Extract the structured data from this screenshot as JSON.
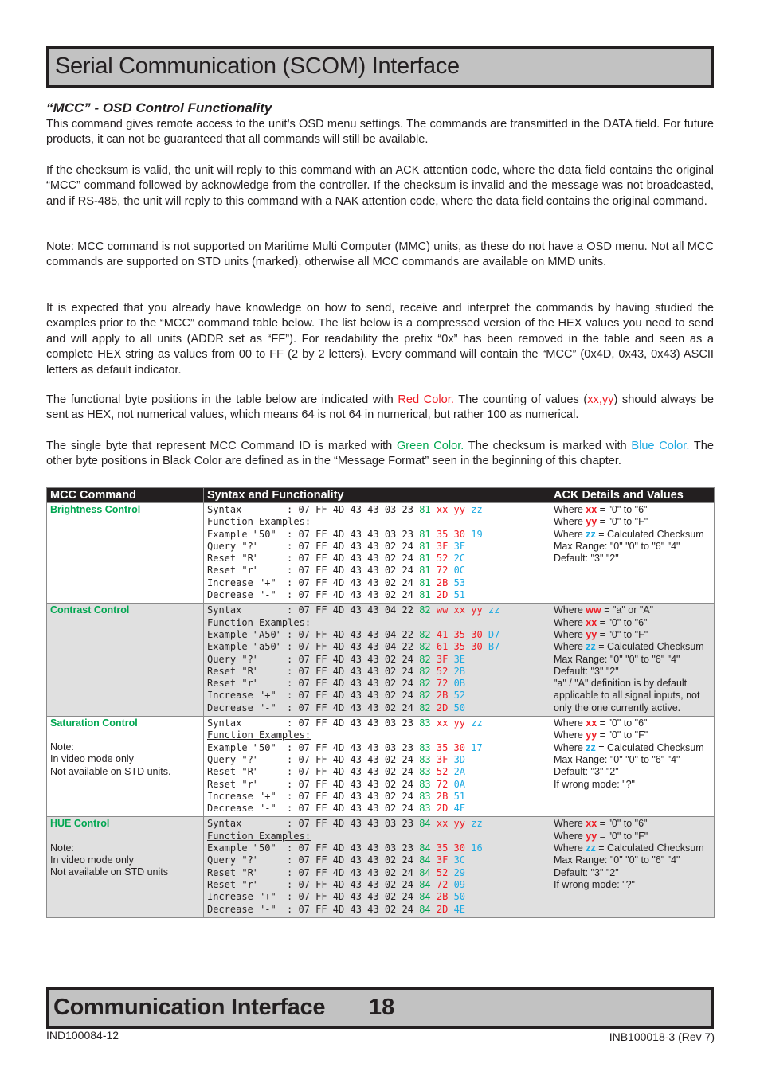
{
  "header": {
    "title": "Serial Communication (SCOM) Interface"
  },
  "section": {
    "heading": "“MCC” - OSD Control Functionality",
    "paragraphs": {
      "p1": "This command gives remote access to the unit’s OSD menu settings. The commands are transmitted in the DATA field. For future products, it can not be guaranteed that all commands will still be available.",
      "p2": "If the checksum is valid, the unit will reply to this command with an ACK attention code, where the data field contains the original “MCC” command followed by acknowledge from the controller. If the checksum is invalid and the message was not broadcasted, and if RS-485, the unit will reply to this command with a NAK attention code, where the data field contains the original command.",
      "p3": "Note: MCC command is not supported on Maritime Multi Computer (MMC) units, as these do not have a OSD menu. Not all MCC commands are supported on STD units (marked), otherwise all MCC commands are available on MMD units.",
      "p4": "It is expected that you already have knowledge on how to send, receive and interpret the commands by having studied the examples prior to the “MCC” command table below. The list below is a compressed version of the HEX values you need to send and will apply to all units (ADDR set as “FF”). For readability the prefix “0x” has been removed in the table and seen as a complete HEX string as values from 00 to FF (2 by 2 letters). Every command will contain the “MCC” (0x4D, 0x43, 0x43) ASCII letters as default indicator.",
      "p5a": "The functional byte positions in the table below are indicated with ",
      "p5red": "Red Color.",
      "p5b": " The counting of values (",
      "p5vals": "xx,yy",
      "p5c": ") should always be sent as HEX, not numerical values, which means 64 is not 64 in numerical, but rather 100 as numerical.",
      "p6a": "The single byte that represent MCC Command ID is marked with ",
      "p6green": "Green Color.",
      "p6b": " The checksum is marked with ",
      "p6blue": "Blue Color.",
      "p6c": " The other byte positions in Black Color are defined as in the “Message Format” seen in the beginning of this chapter."
    }
  },
  "colors": {
    "functional": "#ed1c24",
    "command_id": "#00a650",
    "checksum": "#1ca9e1",
    "header_bg": "#c2c2c2"
  },
  "table": {
    "headers": [
      "MCC Command",
      "Syntax and Functionality",
      "ACK Details and Values"
    ],
    "examples_label": "Function Examples:",
    "rows": [
      {
        "name": "Brightness Control",
        "notes": [],
        "syntax": {
          "label": "Syntax",
          "black": "07 FF 4D 43 43 03 23",
          "green": "81",
          "red": "xx yy",
          "blue": "zz"
        },
        "examples": [
          {
            "label": "Example \"50\"",
            "black": "07 FF 4D 43 43 03 23",
            "green": "81",
            "red": "35 30",
            "blue": "19"
          },
          {
            "label": "Query \"?\"",
            "black": "07 FF 4D 43 43 02 24",
            "green": "81",
            "red": "3F",
            "blue": "3F"
          },
          {
            "label": "Reset \"R\"",
            "black": "07 FF 4D 43 43 02 24",
            "green": "81",
            "red": "52",
            "blue": "2C"
          },
          {
            "label": "Reset \"r\"",
            "black": "07 FF 4D 43 43 02 24",
            "green": "81",
            "red": "72",
            "blue": "0C"
          },
          {
            "label": "Increase \"+\"",
            "black": "07 FF 4D 43 43 02 24",
            "green": "81",
            "red": "2B",
            "blue": "53"
          },
          {
            "label": "Decrease \"-\"",
            "black": "07 FF 4D 43 43 02 24",
            "green": "81",
            "red": "2D",
            "blue": "51"
          }
        ],
        "ack": {
          "where": [
            {
              "var": "xx",
              "color": "red",
              "text": " = \"0\" to \"6\""
            },
            {
              "var": "yy",
              "color": "red",
              "text": " = \"0\" to \"F\""
            },
            {
              "var": "zz",
              "color": "blue",
              "text": " = Calculated Checksum"
            }
          ],
          "max_range": "Max Range: \"0\" \"0\" to \"6\" \"4\"",
          "default": "Default: \"3\" \"2\"",
          "extra": []
        }
      },
      {
        "name": "Contrast Control",
        "notes": [],
        "syntax": {
          "label": "Syntax",
          "black": "07 FF 4D 43 43 04 22",
          "green": "82",
          "red": "ww xx yy",
          "blue": "zz"
        },
        "examples": [
          {
            "label": "Example \"A50\"",
            "black": "07 FF 4D 43 43 04 22",
            "green": "82",
            "red": "41 35 30",
            "blue": "D7"
          },
          {
            "label": "Example \"a50\"",
            "black": "07 FF 4D 43 43 04 22",
            "green": "82",
            "red": "61 35 30",
            "blue": "B7"
          },
          {
            "label": "Query \"?\"",
            "black": "07 FF 4D 43 43 02 24",
            "green": "82",
            "red": "3F",
            "blue": "3E"
          },
          {
            "label": "Reset \"R\"",
            "black": "07 FF 4D 43 43 02 24",
            "green": "82",
            "red": "52",
            "blue": "2B"
          },
          {
            "label": "Reset \"r\"",
            "black": "07 FF 4D 43 43 02 24",
            "green": "82",
            "red": "72",
            "blue": "0B"
          },
          {
            "label": "Increase \"+\"",
            "black": "07 FF 4D 43 43 02 24",
            "green": "82",
            "red": "2B",
            "blue": "52"
          },
          {
            "label": "Decrease \"-\"",
            "black": "07 FF 4D 43 43 02 24",
            "green": "82",
            "red": "2D",
            "blue": "50"
          }
        ],
        "ack": {
          "where": [
            {
              "var": "ww",
              "color": "red",
              "text": " = \"a\" or \"A\""
            },
            {
              "var": "xx",
              "color": "red",
              "text": " = \"0\" to \"6\""
            },
            {
              "var": "yy",
              "color": "red",
              "text": " = \"0\" to \"F\""
            },
            {
              "var": "zz",
              "color": "blue",
              "text": " = Calculated Checksum"
            }
          ],
          "max_range": "Max Range: \"0\" \"0\" to \"6\" \"4\"",
          "default": "Default: \"3\" \"2\"",
          "extra": [
            "\"a\" / \"A\" definition is by default",
            "applicable to all signal inputs, not",
            "only the one currently active."
          ]
        }
      },
      {
        "name": "Saturation Control",
        "notes": [
          "Note:",
          "In video mode only",
          "Not available on STD units."
        ],
        "syntax": {
          "label": "Syntax",
          "black": "07 FF 4D 43 43 03 23",
          "green": "83",
          "red": "xx yy",
          "blue": "zz"
        },
        "examples": [
          {
            "label": "Example \"50\"",
            "black": "07 FF 4D 43 43 03 23",
            "green": "83",
            "red": "35 30",
            "blue": "17"
          },
          {
            "label": "Query \"?\"",
            "black": "07 FF 4D 43 43 02 24",
            "green": "83",
            "red": "3F",
            "blue": "3D"
          },
          {
            "label": "Reset \"R\"",
            "black": "07 FF 4D 43 43 02 24",
            "green": "83",
            "red": "52",
            "blue": "2A"
          },
          {
            "label": "Reset \"r\"",
            "black": "07 FF 4D 43 43 02 24",
            "green": "83",
            "red": "72",
            "blue": "0A"
          },
          {
            "label": "Increase \"+\"",
            "black": "07 FF 4D 43 43 02 24",
            "green": "83",
            "red": "2B",
            "blue": "51"
          },
          {
            "label": "Decrease \"-\"",
            "black": "07 FF 4D 43 43 02 24",
            "green": "83",
            "red": "2D",
            "blue": "4F"
          }
        ],
        "ack": {
          "where": [
            {
              "var": "xx",
              "color": "red",
              "text": " = \"0\" to \"6\""
            },
            {
              "var": "yy",
              "color": "red",
              "text": " = \"0\" to \"F\""
            },
            {
              "var": "zz",
              "color": "blue",
              "text": " = Calculated Checksum"
            }
          ],
          "max_range": "Max Range: \"0\" \"0\" to \"6\" \"4\"",
          "default": "Default: \"3\" \"2\"",
          "extra": [
            "If wrong mode: \"?\""
          ]
        }
      },
      {
        "name": "HUE Control",
        "notes": [
          "Note:",
          "In video mode only",
          "Not available on STD units"
        ],
        "syntax": {
          "label": "Syntax",
          "black": "07 FF 4D 43 43 03 23",
          "green": "84",
          "red": "xx yy",
          "blue": "zz"
        },
        "examples": [
          {
            "label": "Example \"50\"",
            "black": "07 FF 4D 43 43 03 23",
            "green": "84",
            "red": "35 30",
            "blue": "16"
          },
          {
            "label": "Query \"?\"",
            "black": "07 FF 4D 43 43 02 24",
            "green": "84",
            "red": "3F",
            "blue": "3C"
          },
          {
            "label": "Reset \"R\"",
            "black": "07 FF 4D 43 43 02 24",
            "green": "84",
            "red": "52",
            "blue": "29"
          },
          {
            "label": "Reset \"r\"",
            "black": "07 FF 4D 43 43 02 24",
            "green": "84",
            "red": "72",
            "blue": "09"
          },
          {
            "label": "Increase \"+\"",
            "black": "07 FF 4D 43 43 02 24",
            "green": "84",
            "red": "2B",
            "blue": "50"
          },
          {
            "label": "Decrease \"-\"",
            "black": "07 FF 4D 43 43 02 24",
            "green": "84",
            "red": "2D",
            "blue": "4E"
          }
        ],
        "ack": {
          "where": [
            {
              "var": "xx",
              "color": "red",
              "text": " = \"0\" to \"6\""
            },
            {
              "var": "yy",
              "color": "red",
              "text": " = \"0\" to \"F\""
            },
            {
              "var": "zz",
              "color": "blue",
              "text": " = Calculated Checksum"
            }
          ],
          "max_range": "Max Range: \"0\" \"0\" to \"6\" \"4\"",
          "default": "Default: \"3\" \"2\"",
          "extra": [
            "If wrong mode: \"?\""
          ]
        }
      }
    ]
  },
  "footer": {
    "title": "Communication Interface",
    "page_number": "18",
    "doc_id_left": "IND100084-12",
    "doc_id_right": "INB100018-3 (Rev 7)"
  }
}
